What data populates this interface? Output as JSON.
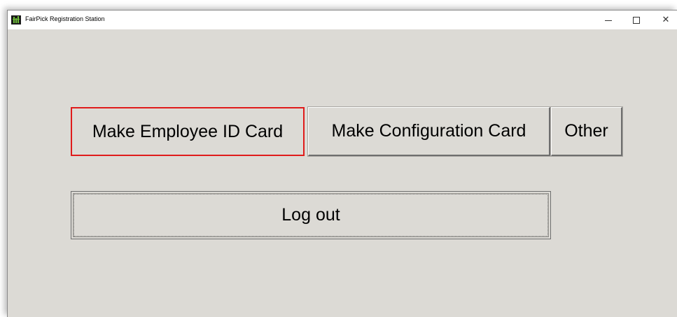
{
  "window": {
    "title": "FairPick Registration Station",
    "app_icon": "fairpick-app-icon",
    "controls": {
      "minimize_icon": "minimize-icon",
      "maximize_icon": "maximize-icon",
      "close_icon": "close-icon",
      "close_glyph": "✕"
    }
  },
  "buttons": {
    "make_employee_id_card": "Make Employee ID Card",
    "make_configuration_card": "Make Configuration Card",
    "other": "Other",
    "log_out": "Log out"
  },
  "colors": {
    "window_background": "#dcdad5",
    "highlight_border": "#e01b1b"
  }
}
